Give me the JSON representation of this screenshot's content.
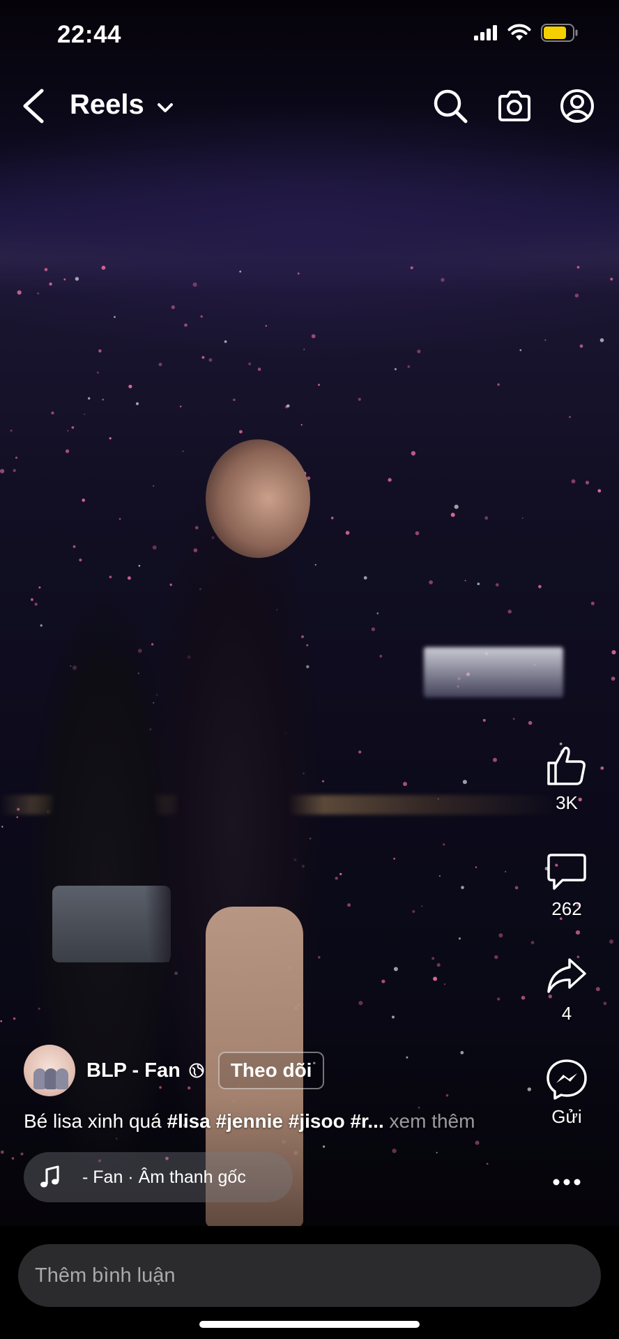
{
  "status_bar": {
    "time": "22:44",
    "icons": [
      "cellular-signal-icon",
      "wifi-icon",
      "battery-icon"
    ],
    "battery_color": "#f5d000"
  },
  "header": {
    "title": "Reels",
    "icons": [
      "back-icon",
      "chevron-down-icon",
      "search-icon",
      "camera-icon",
      "profile-icon"
    ]
  },
  "actions": {
    "like_count": "3K",
    "comment_count": "262",
    "share_count": "4",
    "send_label": "Gửi",
    "icons": [
      "like-icon",
      "comment-icon",
      "share-icon",
      "messenger-icon",
      "more-icon"
    ]
  },
  "post": {
    "author": "BLP - Fan",
    "follow_label": "Theo dõi",
    "caption_text": "Bé lisa xinh quá ",
    "caption_tags": "#lisa #jennie #jisoo #r...",
    "caption_more": " xem thêm",
    "audio": "- Fan · Âm thanh gốc"
  },
  "comment_box": {
    "placeholder": "Thêm bình luận"
  },
  "colors": {
    "background": "#000000",
    "input_bg": "#2b2b2d",
    "pill_bg": "rgba(120,120,130,0.38)"
  }
}
